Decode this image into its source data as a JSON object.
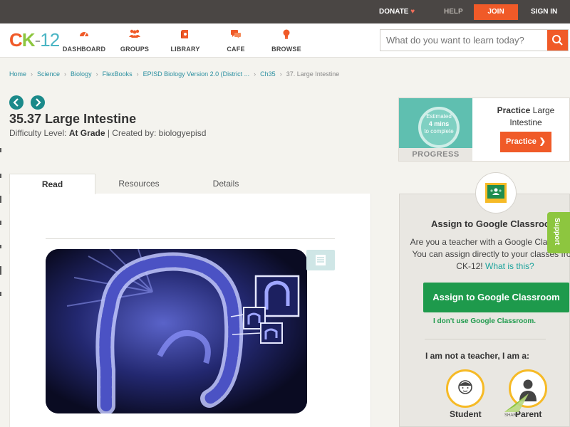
{
  "topbar": {
    "donate": "DONATE",
    "help": "HELP",
    "join": "JOIN",
    "signin": "SIGN IN"
  },
  "logo": {
    "c": "C",
    "k": "K",
    "dash": "-",
    "num": "12"
  },
  "nav": {
    "items": [
      {
        "label": "DASHBOARD",
        "icon": "dashboard-icon"
      },
      {
        "label": "GROUPS",
        "icon": "groups-icon"
      },
      {
        "label": "LIBRARY",
        "icon": "library-icon"
      },
      {
        "label": "CAFE",
        "icon": "cafe-icon"
      },
      {
        "label": "BROWSE",
        "icon": "browse-icon"
      }
    ]
  },
  "search": {
    "placeholder": "What do you want to learn today?"
  },
  "breadcrumb": {
    "items": [
      "Home",
      "Science",
      "Biology",
      "FlexBooks",
      "EPISD Biology Version 2.0 (District ...",
      "Ch35"
    ],
    "current": "37. Large Intestine"
  },
  "page": {
    "title": "35.37 Large Intestine",
    "difficulty_label": "Difficulty Level: ",
    "difficulty_value": "At Grade",
    "created_by": " | Created by: biologyepisd"
  },
  "tabs": [
    "Read",
    "Resources",
    "Details"
  ],
  "practice": {
    "estimated": "Estimated",
    "mins": "4 mins",
    "to_complete": "to complete",
    "progress": "PROGRESS",
    "title_bold": "Practice",
    "title_rest": " Large Intestine",
    "button": "Practice"
  },
  "google": {
    "title": "Assign to Google Classroom",
    "text": "Are you a teacher with a Google Classroom? You can assign directly to your classes from CK-12!",
    "link": "What is this?",
    "button": "Assign to Google Classroom",
    "not_use": "I don't use Google Classroom.",
    "question": "I am not a teacher, I am a:",
    "student": "Student",
    "parent": "Parent"
  },
  "support": "Support",
  "share": "SHARE",
  "colors": {
    "brand_orange": "#f05a28",
    "teal": "#1b8a8a",
    "google_green": "#1e9a4c",
    "support_green": "#8dc63f"
  }
}
